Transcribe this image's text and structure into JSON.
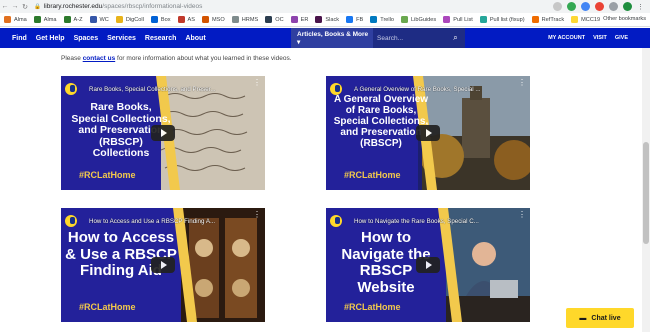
{
  "browser": {
    "url_host": "library.rochester.edu",
    "url_path": "/spaces/rbscp/informational-videos"
  },
  "bookmarks": [
    {
      "label": "Alma",
      "color": "#e1701f"
    },
    {
      "label": "Alma",
      "color": "#2c7a2c"
    },
    {
      "label": "A-Z",
      "color": "#2c7a2c"
    },
    {
      "label": "WC",
      "color": "#3556a8"
    },
    {
      "label": "DigColl",
      "color": "#e8b31a"
    },
    {
      "label": "Box",
      "color": "#0061d5"
    },
    {
      "label": "AS",
      "color": "#c0392b"
    },
    {
      "label": "MSO",
      "color": "#d35400"
    },
    {
      "label": "HRMS",
      "color": "#7f8c8d"
    },
    {
      "label": "OC",
      "color": "#2c3e50"
    },
    {
      "label": "ER",
      "color": "#8e44ad"
    },
    {
      "label": "Slack",
      "color": "#4a154b"
    },
    {
      "label": "FB",
      "color": "#1877f2"
    },
    {
      "label": "Trello",
      "color": "#0079bf"
    },
    {
      "label": "LibGuides",
      "color": "#6aa84f"
    },
    {
      "label": "Pull List",
      "color": "#ab47bc"
    },
    {
      "label": "Pull list (fixup)",
      "color": "#26a69a"
    },
    {
      "label": "RefTrack",
      "color": "#ef6c00"
    },
    {
      "label": "MCC19",
      "color": "#fdd835"
    }
  ],
  "bookmarks_other": "Other bookmarks",
  "nav": {
    "items": [
      "Find",
      "Get Help",
      "Spaces",
      "Services",
      "Research",
      "About"
    ],
    "search_scope": "Articles, Books & More ▾",
    "search_placeholder": "Search...",
    "util": [
      "MY ACCOUNT",
      "VISIT",
      "GIVE"
    ]
  },
  "intro": {
    "before": "Please ",
    "link": "contact us",
    "after": " for more information about what you learned in these videos."
  },
  "videos": [
    {
      "caption": "Rare Books, Special Collections, and Preser...",
      "headline": "Rare Books, Special Collections, and Preservation (RBSCP) Collections",
      "hashtag": "#RCLatHome"
    },
    {
      "caption": "A General Overview of Rare Books, Special ...",
      "headline": "A General Overview of Rare Books, Special Collections, and Preservation (RBSCP)",
      "hashtag": "#RCLatHome"
    },
    {
      "caption": "How to Access and Use a RBSCP Finding A...",
      "headline": "How to Access & Use a RBSCP Finding Aid",
      "hashtag": "#RCLatHome"
    },
    {
      "caption": "How to Navigate the Rare Books, Special C...",
      "headline": "How to Navigate the RBSCP Website",
      "hashtag": "#RCLatHome"
    }
  ],
  "chat": {
    "label": "Chat live"
  },
  "colors": {
    "brand_blue": "#021bc3",
    "gold": "#ffd82a"
  }
}
